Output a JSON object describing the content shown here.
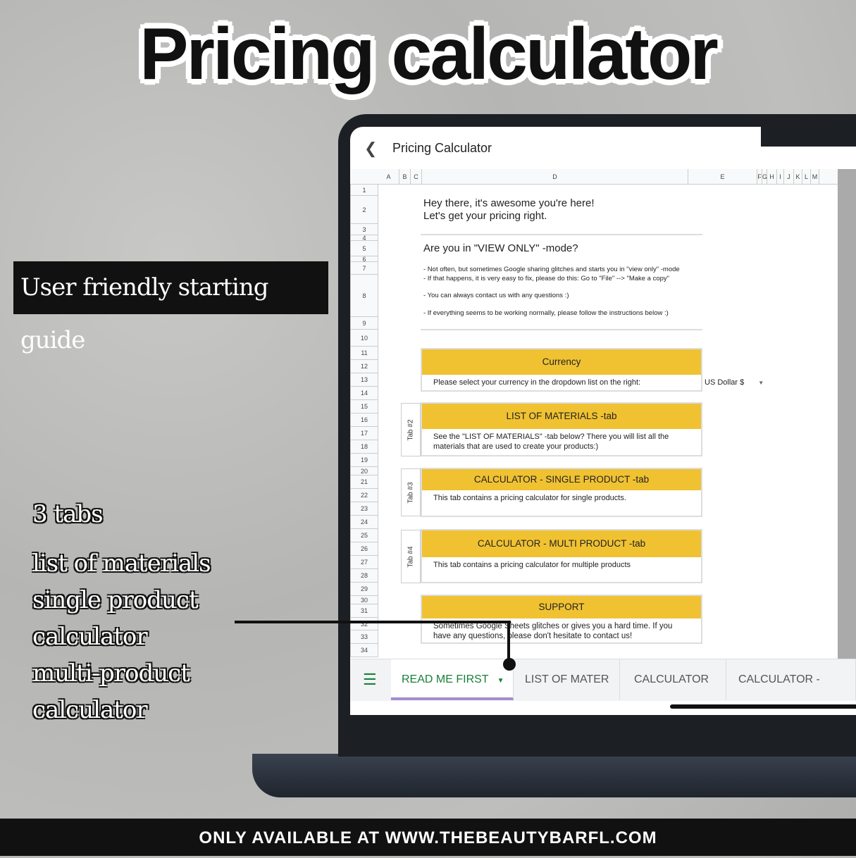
{
  "headline": "Pricing calculator",
  "guide_label": "User friendly starting guide",
  "side_list": [
    "3 tabs",
    "list of materials",
    "single product",
    "calculator",
    "multi-product",
    "calculator"
  ],
  "footer": "ONLY AVAILABLE AT WWW.THEBEAUTYBARFL.COM",
  "app": {
    "title": "Pricing Calculator",
    "back_icon": "chevron-left-icon"
  },
  "columns": [
    "A",
    "B",
    "C",
    "D",
    "E",
    "F",
    "G",
    "H",
    "I",
    "J",
    "K",
    "L",
    "M"
  ],
  "rows": [
    "1",
    "2",
    "3",
    "4",
    "5",
    "6",
    "7",
    "8",
    "9",
    "10",
    "11",
    "12",
    "13",
    "14",
    "15",
    "16",
    "17",
    "18",
    "19",
    "20",
    "21",
    "22",
    "23",
    "24",
    "25",
    "26",
    "27",
    "28",
    "29",
    "30",
    "31",
    "32",
    "33",
    "34"
  ],
  "intro": {
    "line1": "Hey there, it's awesome you're here!",
    "line2": "Let's get your pricing right."
  },
  "view_only": {
    "heading": "Are you in \"VIEW ONLY\" -mode?",
    "lines": [
      "- Not often, but sometimes Google sharing glitches and starts you in \"view only\" -mode",
      "- If that happens, it is very easy to fix, please do this: Go to \"File\" --> \"Make a copy\"",
      "- You can always contact us with any questions :)",
      "- If everything seems to be working normally, please follow the instructions below :)"
    ]
  },
  "currency": {
    "header": "Currency",
    "body": "Please select your currency in the dropdown list on the right:",
    "value": "US Dollar $"
  },
  "sections": [
    {
      "tab": "Tab #2",
      "header": "LIST OF MATERIALS -tab",
      "body": "See the \"LIST OF MATERIALS\" -tab below? There you will list all the materials that are used to create your products:)"
    },
    {
      "tab": "Tab #3",
      "header": "CALCULATOR - SINGLE PRODUCT -tab",
      "body": "This tab contains a pricing calculator for single products."
    },
    {
      "tab": "Tab #4",
      "header": "CALCULATOR - MULTI PRODUCT -tab",
      "body": "This tab contains a pricing calculator for multiple products"
    }
  ],
  "support": {
    "header": "SUPPORT",
    "body": "Sometimes Google Sheets glitches or gives you a hard time. If you have any questions, please don't hesitate to contact us!"
  },
  "sheet_tabs": [
    {
      "label": "READ ME FIRST",
      "active": true
    },
    {
      "label": "LIST OF MATER"
    },
    {
      "label": "CALCULATOR"
    },
    {
      "label": "CALCULATOR -"
    }
  ],
  "colors": {
    "accent": "#f0c232",
    "active_tab": "#188038",
    "tab_underline": "#a78bd0"
  }
}
